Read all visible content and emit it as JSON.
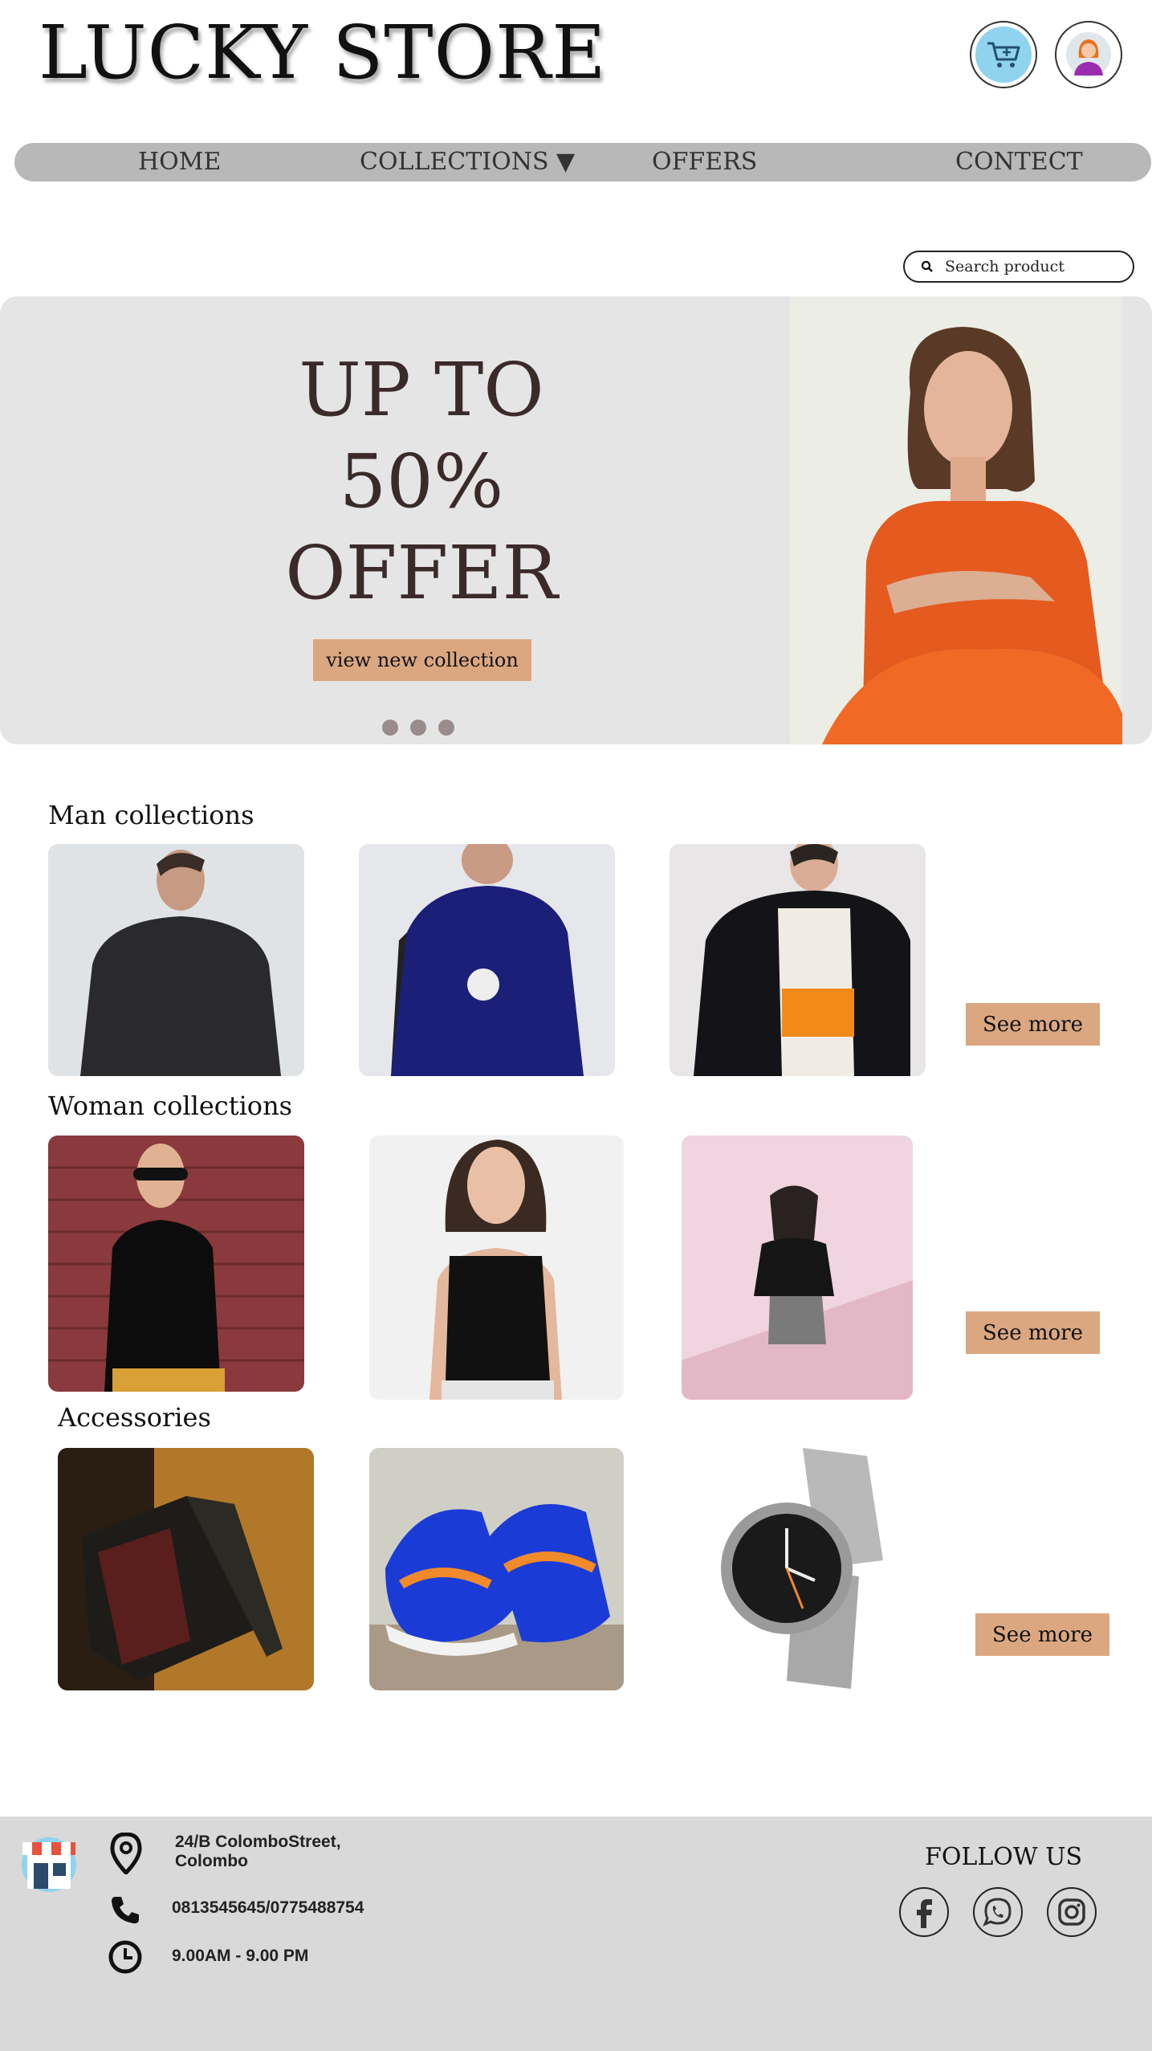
{
  "header": {
    "logo": "LUCKY STORE",
    "cart_icon": "cart-icon",
    "user_icon": "user-avatar-icon"
  },
  "nav": {
    "items": [
      {
        "label": "HOME"
      },
      {
        "label": "COLLECTIONS ▼"
      },
      {
        "label": "OFFERS"
      },
      {
        "label": "CONTECT"
      }
    ]
  },
  "search": {
    "placeholder": "Search product",
    "icon": "search-icon"
  },
  "hero": {
    "line1": "UP TO",
    "line2": "50%",
    "line3": "OFFER",
    "button": "view new collection",
    "slide_count": 3
  },
  "sections": {
    "men": {
      "title": "Man collections",
      "see_more": "See more"
    },
    "women": {
      "title": "Woman collections",
      "see_more": "See more"
    },
    "accessories": {
      "title": "Accessories",
      "see_more": "See more"
    }
  },
  "footer": {
    "store_icon": "store-icon",
    "address_line1": "24/B ColomboStreet,",
    "address_line2": "Colombo",
    "phone": "0813545645/0775488754",
    "hours": "9.00AM - 9.00 PM",
    "follow": "FOLLOW US",
    "socials": [
      "facebook-icon",
      "whatsapp-icon",
      "instagram-icon"
    ]
  },
  "colors": {
    "accent": "#dba781",
    "nav_bg": "#b8b8b8",
    "hero_bg": "#e5e5e5",
    "footer_bg": "#d9d9d9",
    "hero_text": "#3b2a2a"
  }
}
